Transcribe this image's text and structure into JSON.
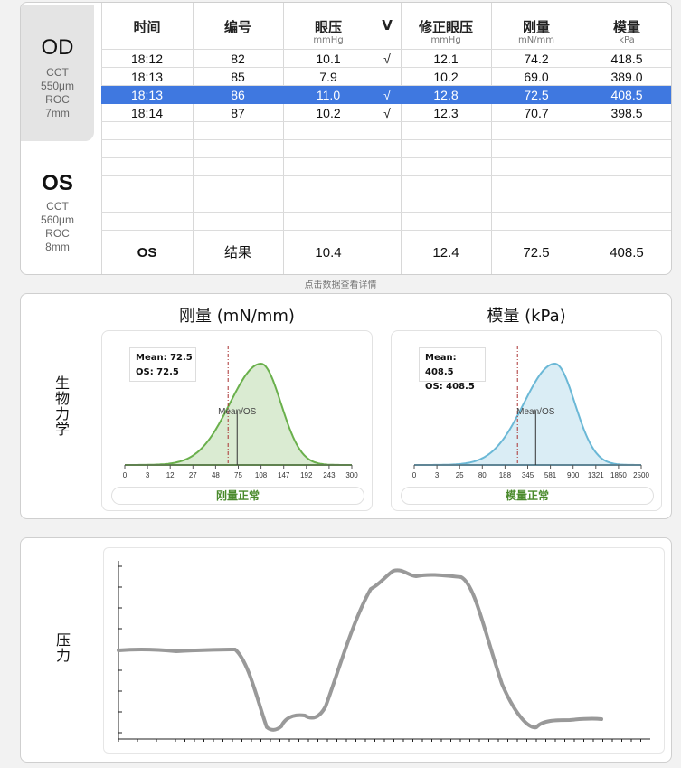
{
  "eyes": {
    "od": {
      "name": "OD",
      "cct": "CCT",
      "cct_val": "550μm",
      "roc": "ROC",
      "roc_val": "7mm"
    },
    "os": {
      "name": "OS",
      "cct": "CCT",
      "cct_val": "560μm",
      "roc": "ROC",
      "roc_val": "8mm"
    }
  },
  "table": {
    "headers": [
      {
        "title": "时间",
        "unit": ""
      },
      {
        "title": "编号",
        "unit": ""
      },
      {
        "title": "眼压",
        "unit": "mmHg"
      },
      {
        "title": "V",
        "unit": ""
      },
      {
        "title": "修正眼压",
        "unit": "mmHg"
      },
      {
        "title": "刚量",
        "unit": "mN/mm"
      },
      {
        "title": "模量",
        "unit": "kPa"
      }
    ],
    "rows": [
      {
        "time": "18:12",
        "id": "82",
        "iop": "10.1",
        "v": "√",
        "ciop": "12.1",
        "stiff": "74.2",
        "mod": "418.5",
        "selected": false
      },
      {
        "time": "18:13",
        "id": "85",
        "iop": "7.9",
        "v": "",
        "ciop": "10.2",
        "stiff": "69.0",
        "mod": "389.0",
        "selected": false
      },
      {
        "time": "18:13",
        "id": "86",
        "iop": "11.0",
        "v": "√",
        "ciop": "12.8",
        "stiff": "72.5",
        "mod": "408.5",
        "selected": true
      },
      {
        "time": "18:14",
        "id": "87",
        "iop": "10.2",
        "v": "√",
        "ciop": "12.3",
        "stiff": "70.7",
        "mod": "398.5",
        "selected": false
      }
    ],
    "result": {
      "eye": "OS",
      "label": "结果",
      "iop": "10.4",
      "ciop": "12.4",
      "stiff": "72.5",
      "mod": "408.5"
    },
    "hint": "点击数据查看详情"
  },
  "biomech": {
    "label": "生物力学",
    "stiffness": {
      "title": "刚量 (mN/mm)",
      "legend_mean": "Mean: 72.5",
      "legend_os": "OS: 72.5",
      "marker_label": "Mean/OS",
      "ticks": [
        "0",
        "3",
        "12",
        "27",
        "48",
        "75",
        "108",
        "147",
        "192",
        "243",
        "300"
      ],
      "status": "刚量正常",
      "color": "#6ab04c"
    },
    "modulus": {
      "title": "模量 (kPa)",
      "legend_mean": "Mean: 408.5",
      "legend_os": "OS: 408.5",
      "marker_label": "Mean/OS",
      "ticks": [
        "0",
        "3",
        "25",
        "80",
        "188",
        "345",
        "581",
        "900",
        "1321",
        "1850",
        "2500"
      ],
      "status": "模量正常",
      "color": "#6bb8d6"
    }
  },
  "pressure": {
    "label": "压力"
  }
}
